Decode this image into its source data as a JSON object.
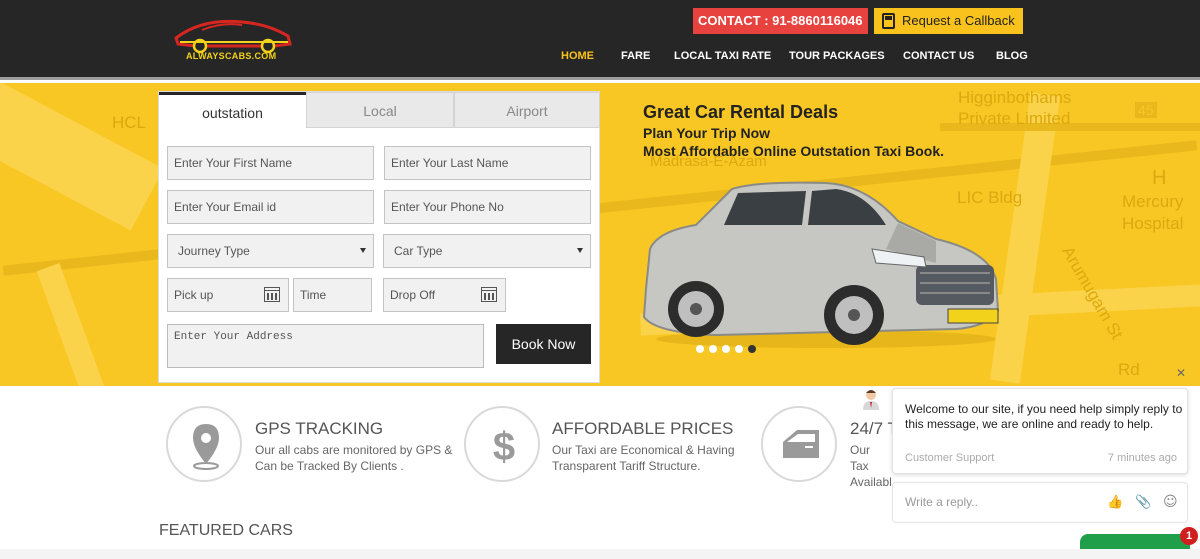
{
  "header": {
    "logo_text": "ALWAYSCABS.COM",
    "contact": "CONTACT : 91-8860116046",
    "callback": "Request a Callback",
    "nav": [
      "HOME",
      "FARE",
      "LOCAL TAXI RATE",
      "TOUR PACKAGES",
      "CONTACT US",
      "BLOG"
    ],
    "active_nav": "HOME"
  },
  "form": {
    "tabs": [
      "outstation",
      "Local",
      "Airport"
    ],
    "active_tab": "outstation",
    "first_name_placeholder": "Enter Your First Name",
    "last_name_placeholder": "Enter Your Last Name",
    "email_placeholder": "Enter Your Email id",
    "phone_placeholder": "Enter Your Phone No",
    "journey_type": "Journey Type",
    "car_type": "Car Type",
    "pickup_placeholder": "Pick up",
    "time_placeholder": "Time",
    "dropoff_placeholder": "Drop Off",
    "address_placeholder": "Enter Your Address",
    "book_label": "Book Now"
  },
  "hero": {
    "title": "Great Car Rental Deals",
    "line1": "Plan Your Trip Now",
    "line2": "Most Affordable Online Outstation Taxi Book.",
    "map_labels": [
      "Higginbothams",
      "Private Limited",
      "Madrasa-E-Azam",
      "LIC Bldg",
      "Mercury",
      "Hospital",
      "HCL",
      "Arumugam St",
      "Rd",
      "45",
      "H"
    ],
    "slide_count": 5,
    "active_slide": 5
  },
  "features": [
    {
      "title": "GPS TRACKING",
      "desc": "Our all cabs are monitored by GPS & Can be Tracked By Clients .",
      "icon": "location-pin-icon"
    },
    {
      "title": "AFFORDABLE PRICES",
      "desc": "Our Taxi are Economical & Having Transparent Tariff Structure.",
      "icon": "dollar-icon"
    },
    {
      "title": "24/7 T",
      "desc": "Our Tax Availabl",
      "icon": "car-door-icon"
    }
  ],
  "featured_heading": "FEATURED CARS",
  "chat": {
    "message": "Welcome to our site, if you need help simply reply to this message, we are online and ready to help.",
    "author": "Customer Support",
    "time": "7 minutes ago",
    "reply_placeholder": "Write a reply..",
    "badge": "1"
  },
  "colors": {
    "accent": "#f9c21d",
    "header": "#262626",
    "contact": "#e8423f",
    "chat_button": "#1f9f4a"
  }
}
